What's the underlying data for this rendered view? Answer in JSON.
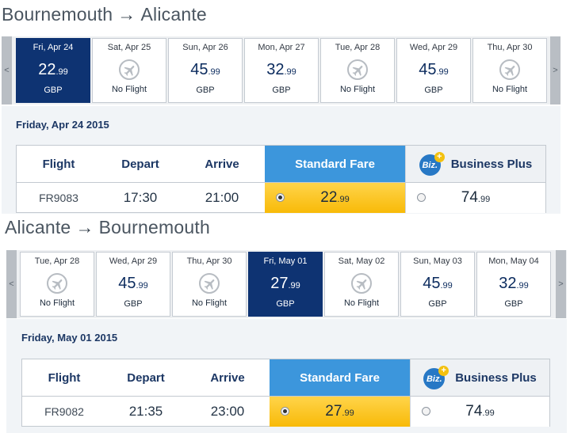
{
  "outbound": {
    "title": {
      "from": "Bournemouth",
      "arrow": "→",
      "to": "Alicante"
    },
    "nav": {
      "prev": "<",
      "next": ">"
    },
    "days": [
      {
        "label": "Fri, Apr 24",
        "price_main": "22",
        "price_cents": ".99",
        "currency": "GBP",
        "selected": true
      },
      {
        "label": "Sat, Apr 25",
        "no_flight": "No Flight"
      },
      {
        "label": "Sun, Apr 26",
        "price_main": "45",
        "price_cents": ".99",
        "currency": "GBP"
      },
      {
        "label": "Mon, Apr 27",
        "price_main": "32",
        "price_cents": ".99",
        "currency": "GBP"
      },
      {
        "label": "Tue, Apr 28",
        "no_flight": "No Flight"
      },
      {
        "label": "Wed, Apr 29",
        "price_main": "45",
        "price_cents": ".99",
        "currency": "GBP"
      },
      {
        "label": "Thu, Apr 30",
        "no_flight": "No Flight"
      }
    ],
    "date_heading": "Friday, Apr 24 2015",
    "table": {
      "headers": {
        "flight": "Flight",
        "depart": "Depart",
        "arrive": "Arrive",
        "standard": "Standard Fare",
        "biz_logo": "Biz.",
        "biz_plus": "+",
        "business": "Business Plus"
      },
      "row": {
        "flight": "FR9083",
        "depart": "17:30",
        "arrive": "21:00",
        "std_main": "22",
        "std_cents": ".99",
        "biz_main": "74",
        "biz_cents": ".99"
      }
    }
  },
  "return": {
    "title": {
      "from": "Alicante",
      "arrow": "→",
      "to": "Bournemouth"
    },
    "nav": {
      "prev": "<",
      "next": ">"
    },
    "days": [
      {
        "label": "Tue, Apr 28",
        "no_flight": "No Flight"
      },
      {
        "label": "Wed, Apr 29",
        "price_main": "45",
        "price_cents": ".99",
        "currency": "GBP"
      },
      {
        "label": "Thu, Apr 30",
        "no_flight": "No Flight"
      },
      {
        "label": "Fri, May 01",
        "price_main": "27",
        "price_cents": ".99",
        "currency": "GBP",
        "selected": true
      },
      {
        "label": "Sat, May 02",
        "no_flight": "No Flight"
      },
      {
        "label": "Sun, May 03",
        "price_main": "45",
        "price_cents": ".99",
        "currency": "GBP"
      },
      {
        "label": "Mon, May 04",
        "price_main": "32",
        "price_cents": ".99",
        "currency": "GBP"
      }
    ],
    "date_heading": "Friday, May 01 2015",
    "table": {
      "headers": {
        "flight": "Flight",
        "depart": "Depart",
        "arrive": "Arrive",
        "standard": "Standard Fare",
        "biz_logo": "Biz.",
        "biz_plus": "+",
        "business": "Business Plus"
      },
      "row": {
        "flight": "FR9082",
        "depart": "21:35",
        "arrive": "23:00",
        "std_main": "27",
        "std_cents": ".99",
        "biz_main": "74",
        "biz_cents": ".99"
      }
    }
  },
  "colors": {
    "selected_day": "#0e3372",
    "standard_header": "#3c96dc",
    "standard_fare": "#f8ba08",
    "biz_logo": "#2778c5"
  },
  "icons": {
    "no_flight": "plane-icon"
  }
}
